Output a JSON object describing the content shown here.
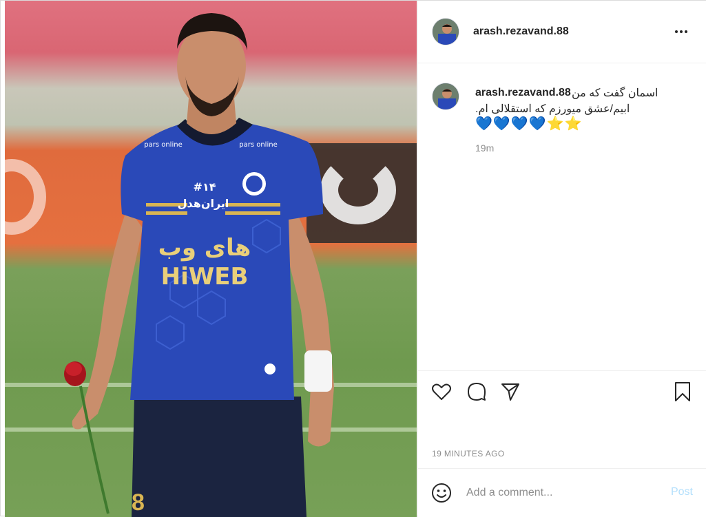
{
  "post": {
    "image_alt": "Player in blue jersey holding a red rose on a football pitch",
    "jersey": {
      "sponsor_fa": "های وب",
      "sponsor_en": "HiWEB",
      "number_text": "#۱۴",
      "brand_fa": "ایران‌هدل",
      "sleeve_brand": "pars online"
    }
  },
  "header": {
    "username": "arash.rezavand.88"
  },
  "comment": {
    "username": "arash.rezavand.88",
    "caption_line1": "اسمان گفت که من",
    "caption_line2": ".ابیم/عشق میورزم که استقلالی ام",
    "hearts": "💙💙💙💙",
    "stars": "⭐⭐",
    "time": "19m"
  },
  "footer": {
    "time_ago": "19 MINUTES AGO",
    "comment_placeholder": "Add a comment...",
    "post_label": "Post"
  },
  "icons": {
    "like": "heart-icon",
    "comment": "comment-icon",
    "share": "share-icon",
    "save": "bookmark-icon",
    "emoji": "smiley-icon",
    "more": "more-options-icon"
  },
  "colors": {
    "jersey_blue": "#2a49b8",
    "heart_blue": "#29a8e0",
    "star_yellow": "#f1c12c",
    "post_disabled": "#b2dffc"
  }
}
